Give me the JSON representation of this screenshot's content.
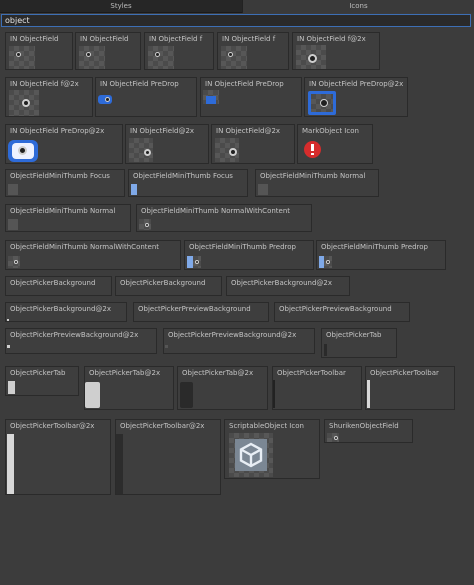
{
  "tabs": [
    {
      "label": "Styles",
      "active": true
    },
    {
      "label": "Icons",
      "active": false
    }
  ],
  "search": {
    "value": "object"
  },
  "styles": [
    {
      "label": "IN ObjectField"
    },
    {
      "label": "IN ObjectField"
    },
    {
      "label": "IN ObjectField f"
    },
    {
      "label": "IN ObjectField f"
    },
    {
      "label": "IN ObjectField f@2x"
    },
    {
      "label": "IN ObjectField f@2x"
    },
    {
      "label": "IN ObjectField PreDrop"
    },
    {
      "label": "IN ObjectField PreDrop"
    },
    {
      "label": "IN ObjectField PreDrop@2x"
    },
    {
      "label": "IN ObjectField PreDrop@2x"
    },
    {
      "label": "IN ObjectField@2x"
    },
    {
      "label": "IN ObjectField@2x"
    },
    {
      "label": "MarkObject Icon"
    },
    {
      "label": "ObjectFieldMiniThumb Focus"
    },
    {
      "label": "ObjectFieldMiniThumb Focus"
    },
    {
      "label": "ObjectFieldMiniThumb Normal"
    },
    {
      "label": "ObjectFieldMiniThumb Normal"
    },
    {
      "label": "ObjectFieldMiniThumb NormalWithContent"
    },
    {
      "label": "ObjectFieldMiniThumb NormalWithContent"
    },
    {
      "label": "ObjectFieldMiniThumb Predrop"
    },
    {
      "label": "ObjectFieldMiniThumb Predrop"
    },
    {
      "label": "ObjectPickerBackground"
    },
    {
      "label": "ObjectPickerBackground"
    },
    {
      "label": "ObjectPickerBackground@2x"
    },
    {
      "label": "ObjectPickerBackground@2x"
    },
    {
      "label": "ObjectPickerPreviewBackground"
    },
    {
      "label": "ObjectPickerPreviewBackground"
    },
    {
      "label": "ObjectPickerPreviewBackground@2x"
    },
    {
      "label": "ObjectPickerPreviewBackground@2x"
    },
    {
      "label": "ObjectPickerTab"
    },
    {
      "label": "ObjectPickerTab"
    },
    {
      "label": "ObjectPickerTab@2x"
    },
    {
      "label": "ObjectPickerTab@2x"
    },
    {
      "label": "ObjectPickerToolbar"
    },
    {
      "label": "ObjectPickerToolbar"
    },
    {
      "label": "ObjectPickerToolbar@2x"
    },
    {
      "label": "ObjectPickerToolbar@2x"
    },
    {
      "label": "ScriptableObject Icon"
    },
    {
      "label": "ShurikenObjectField"
    }
  ]
}
